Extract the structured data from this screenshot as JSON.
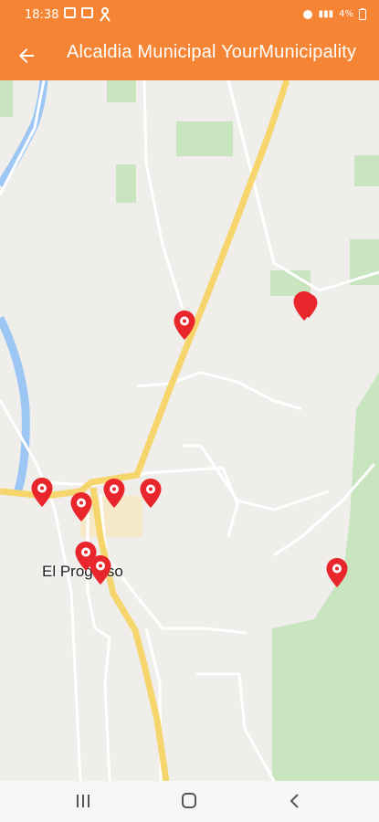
{
  "status_bar": {
    "time": "18:38",
    "battery": "4%",
    "icons": [
      "image-icon",
      "app-icon",
      "person-icon",
      "alarm-icon",
      "signal-icon",
      "battery-icon"
    ]
  },
  "app_bar": {
    "back_icon": "arrow-left-icon",
    "title": "Alcaldia Municipal YourMunicipality"
  },
  "map": {
    "place_label": "El Progreso",
    "marker_icon": "location-pin-icon",
    "marker_color": "#e8262c",
    "road_color": "#f6d56c",
    "water_color": "#9cc6f4",
    "park_color": "#c8e5c0",
    "marker_count": 10
  },
  "navigation": {
    "buttons": [
      "recents-icon",
      "home-icon",
      "back-icon"
    ]
  },
  "colors": {
    "primary": "#f58534"
  }
}
